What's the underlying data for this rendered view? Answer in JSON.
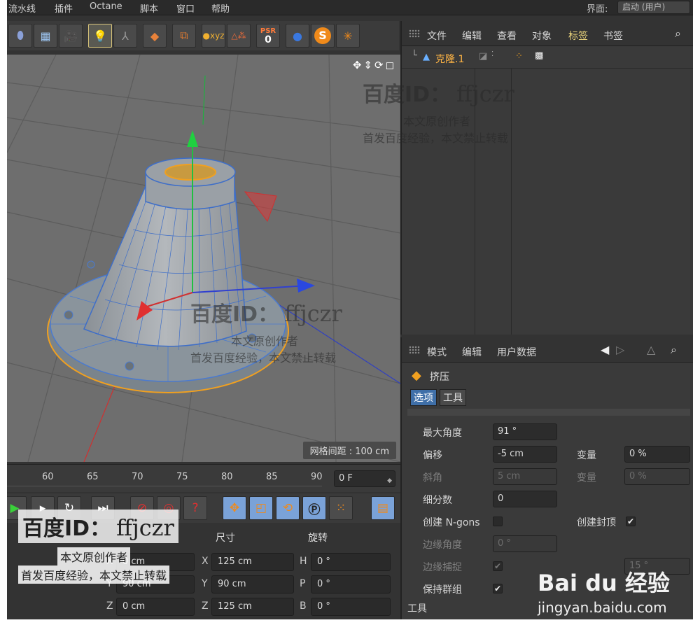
{
  "menubar": {
    "items": [
      "流水线",
      "插件",
      "Octane",
      "脚本",
      "窗口",
      "帮助"
    ],
    "layout_label": "界面:",
    "layout_value": "启动 (用户)"
  },
  "toolbar": {
    "psr_label": "PSR",
    "psr_value": "0"
  },
  "viewport": {
    "grid_distance": "网格间距 : 100 cm"
  },
  "timeline": {
    "ticks": [
      "60",
      "65",
      "70",
      "75",
      "80",
      "85",
      "90"
    ],
    "current_frame": "0 F"
  },
  "coords": {
    "headers": [
      "尺寸",
      "旋转"
    ],
    "rows": [
      {
        "pos_label": "X",
        "pos_value": "0 cm",
        "size_label": "X",
        "size_value": "125 cm",
        "rot_label": "H",
        "rot_value": "0 °"
      },
      {
        "pos_label": "Y",
        "pos_value": "90 cm",
        "size_label": "Y",
        "size_value": "90 cm",
        "rot_label": "P",
        "rot_value": "0 °"
      },
      {
        "pos_label": "Z",
        "pos_value": "0 cm",
        "size_label": "Z",
        "size_value": "125 cm",
        "rot_label": "B",
        "rot_value": "0 °"
      }
    ]
  },
  "object_manager": {
    "menu": [
      "文件",
      "编辑",
      "查看",
      "对象",
      "标签",
      "书签"
    ],
    "highlighted_menu": "标签",
    "object_name": "克隆.1"
  },
  "attribute_manager": {
    "menu": [
      "模式",
      "编辑",
      "用户数据"
    ],
    "object_title": "挤压",
    "tabs": [
      "选项",
      "工具"
    ],
    "fields": {
      "max_angle": {
        "label": "最大角度",
        "value": "91 °"
      },
      "offset": {
        "label": "偏移",
        "value": "-5 cm"
      },
      "bevel": {
        "label": "斜角",
        "value": "5 cm"
      },
      "subdivision": {
        "label": "细分数",
        "value": "0"
      },
      "variance1": {
        "label": "变量",
        "value": "0 %"
      },
      "variance2": {
        "label": "变量",
        "value": "0 %"
      },
      "ngons": {
        "label": "创建 N-gons"
      },
      "caps": {
        "label": "创建封顶"
      },
      "edge_angle": {
        "label": "边缘角度",
        "value": "0 °"
      },
      "edge_snap": {
        "label": "边缘捕捉"
      },
      "edge_snap_value": "15 °",
      "keep_groups": {
        "label": "保持群组"
      }
    },
    "section_tool": "工具"
  },
  "watermark": {
    "id_text": "百度ID：",
    "user": "ffjczr",
    "line1": "本文原创作者",
    "line2": "首发百度经验，本文禁止转载",
    "logo_text": "Bai du 经验",
    "logo_url": "jingyan.baidu.com"
  }
}
